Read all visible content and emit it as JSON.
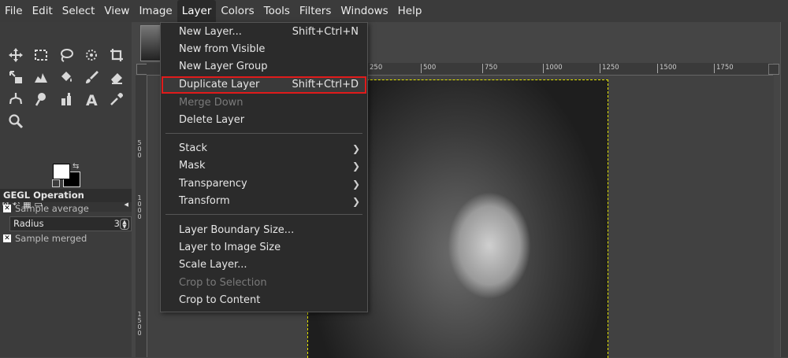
{
  "menubar": {
    "items": [
      "File",
      "Edit",
      "Select",
      "View",
      "Image",
      "Layer",
      "Colors",
      "Tools",
      "Filters",
      "Windows",
      "Help"
    ],
    "active": "Layer"
  },
  "layer_menu": {
    "items": [
      {
        "label": "New Layer...",
        "shortcut": "Shift+Ctrl+N"
      },
      {
        "label": "New from Visible",
        "shortcut": ""
      },
      {
        "label": "New Layer Group",
        "shortcut": ""
      },
      {
        "label": "Duplicate Layer",
        "shortcut": "Shift+Ctrl+D",
        "highlighted": true
      },
      {
        "label": "Merge Down",
        "shortcut": "",
        "disabled": true
      },
      {
        "label": "Delete Layer",
        "shortcut": ""
      },
      {
        "label": "Stack",
        "submenu": true
      },
      {
        "label": "Mask",
        "submenu": true
      },
      {
        "label": "Transparency",
        "submenu": true
      },
      {
        "label": "Transform",
        "submenu": true
      },
      {
        "label": "Layer Boundary Size...",
        "shortcut": ""
      },
      {
        "label": "Layer to Image Size",
        "shortcut": ""
      },
      {
        "label": "Scale Layer...",
        "shortcut": ""
      },
      {
        "label": "Crop to Selection",
        "shortcut": "",
        "disabled": true
      },
      {
        "label": "Crop to Content",
        "shortcut": ""
      }
    ]
  },
  "tool_options": {
    "title": "GEGL Operation",
    "sample_average": "Sample average",
    "radius_label": "Radius",
    "radius_value": "3",
    "sample_merged": "Sample merged"
  },
  "ruler": {
    "h_marks": [
      "250",
      "500",
      "750",
      "1000",
      "1250",
      "1500",
      "1750"
    ],
    "v_marks": [
      "5",
      "0",
      "0",
      "1",
      "0",
      "0",
      "0",
      "1",
      "5",
      "0",
      "0"
    ]
  },
  "colors": {
    "highlight_outline": "#e01b1b",
    "selection_border": "#e6e600"
  }
}
